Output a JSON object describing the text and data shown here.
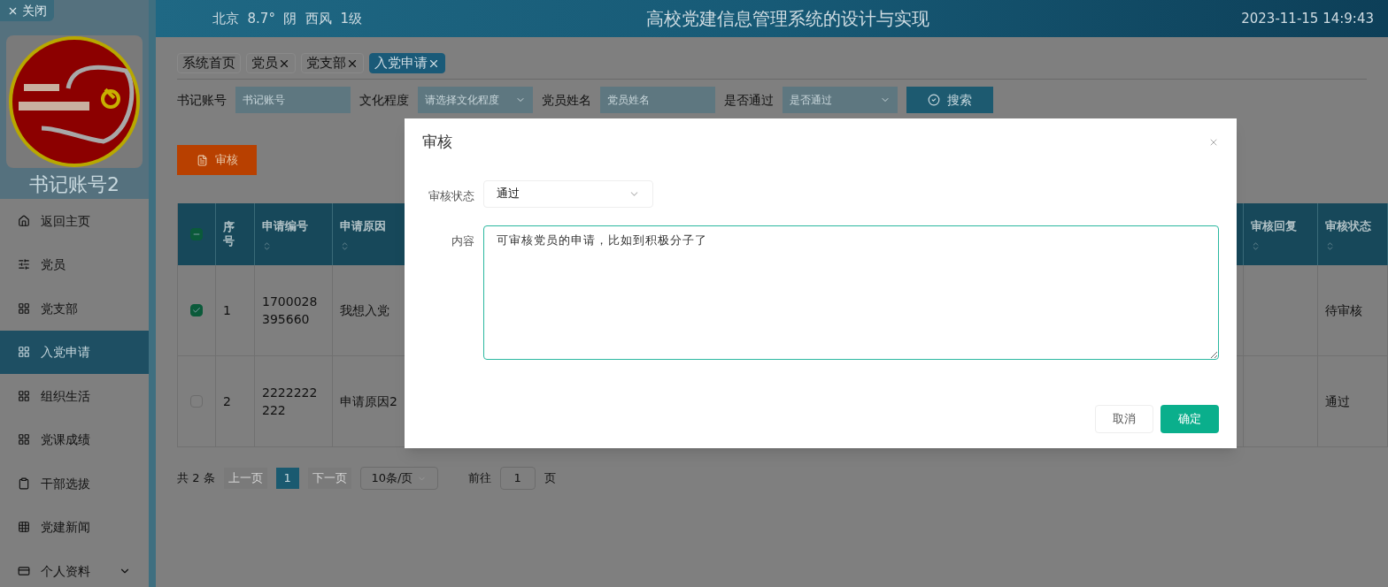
{
  "header": {
    "weather": "北京  8.7°  阴  西风  1级",
    "title": "高校党建信息管理系统的设计与实现",
    "datetime": "2023-11-15 14:9:43"
  },
  "sidebar": {
    "close_label": "关闭",
    "user_name": "书记账号2",
    "items": [
      {
        "label": "返回主页",
        "selected": false
      },
      {
        "label": "党员",
        "selected": false
      },
      {
        "label": "党支部",
        "selected": false
      },
      {
        "label": "入党申请",
        "selected": true
      },
      {
        "label": "组织生活",
        "selected": false
      },
      {
        "label": "党课成绩",
        "selected": false
      },
      {
        "label": "干部选拔",
        "selected": false
      },
      {
        "label": "党建新闻",
        "selected": false
      },
      {
        "label": "个人资料",
        "selected": false,
        "expanded": false
      }
    ]
  },
  "tabs": [
    {
      "label": "系统首页",
      "selected": false,
      "closable": false
    },
    {
      "label": "党员",
      "selected": false,
      "closable": true
    },
    {
      "label": "党支部",
      "selected": false,
      "closable": true
    },
    {
      "label": "入党申请",
      "selected": true,
      "closable": true
    }
  ],
  "filters": [
    {
      "label": "书记账号",
      "placeholder": "书记账号",
      "kind": "input"
    },
    {
      "label": "文化程度",
      "placeholder": "请选择文化程度",
      "kind": "select"
    },
    {
      "label": "党员姓名",
      "placeholder": "党员姓名",
      "kind": "input"
    },
    {
      "label": "是否通过",
      "placeholder": "是否通过",
      "kind": "select"
    }
  ],
  "search_button": "搜索",
  "action_button": "审核",
  "table": {
    "header_checkbox": {
      "checked": true,
      "indeterminate": true
    },
    "columns": [
      {
        "label": "序号",
        "sortable": false
      },
      {
        "label": "申请编号",
        "sortable": true
      },
      {
        "label": "申请原因",
        "sortable": true
      },
      {
        "label": "审核回复",
        "sortable": true
      },
      {
        "label": "审核状态",
        "sortable": true
      }
    ],
    "rows": [
      {
        "checked": true,
        "cells": [
          "1",
          "1700028395660",
          "我想入党",
          "",
          "待审核"
        ]
      },
      {
        "checked": false,
        "cells": [
          "2",
          "2222222222",
          "申请原因2",
          "",
          "通过"
        ]
      }
    ]
  },
  "pagination": {
    "total": "共 2 条",
    "prev": "上一页",
    "pages": [
      {
        "label": "1",
        "selected": true
      }
    ],
    "next": "下一页",
    "page_size": "10条/页",
    "goto_label": "前往",
    "goto_value": "1",
    "goto_suffix": "页"
  },
  "dialog": {
    "title": "审核",
    "fields": [
      {
        "label": "审核状态",
        "kind": "select",
        "value": "通过"
      },
      {
        "label": "内容",
        "kind": "textarea",
        "value": "可审核党员的申请，比如到积极分子了"
      }
    ],
    "buttons": [
      {
        "label": "取消",
        "kind": "default"
      },
      {
        "label": "确定",
        "kind": "primary"
      }
    ]
  }
}
